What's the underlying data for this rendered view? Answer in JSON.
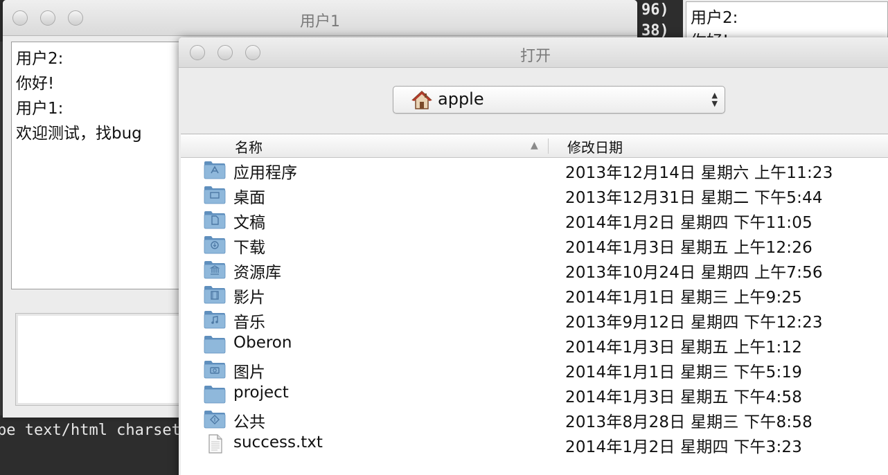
{
  "terminal": {
    "bottom_line": "pe text/html charset",
    "top_glyphs": [
      "96)",
      "38)"
    ]
  },
  "background_chat": {
    "text": "用户2:\n你好!"
  },
  "chat_window": {
    "title": "用户1",
    "log_text": "用户2:\n你好!\n用户1:\n欢迎测试，找bug",
    "input_value": ""
  },
  "open_dialog": {
    "title": "打开",
    "location": {
      "label": "apple",
      "icon": "home-icon"
    },
    "columns": {
      "name": "名称",
      "date": "修改日期",
      "sort_indicator": "▲"
    },
    "files": [
      {
        "name": "应用程序",
        "date": "2013年12月14日 星期六 上午11:23",
        "icon": "applications-folder-icon"
      },
      {
        "name": "桌面",
        "date": "2013年12月31日 星期二 下午5:44",
        "icon": "desktop-folder-icon"
      },
      {
        "name": "文稿",
        "date": "2014年1月2日 星期四 下午11:05",
        "icon": "documents-folder-icon"
      },
      {
        "name": "下载",
        "date": "2014年1月3日 星期五 上午12:26",
        "icon": "downloads-folder-icon"
      },
      {
        "name": "资源库",
        "date": "2013年10月24日 星期四 上午7:56",
        "icon": "library-folder-icon"
      },
      {
        "name": "影片",
        "date": "2014年1月1日 星期三 上午9:25",
        "icon": "movies-folder-icon"
      },
      {
        "name": "音乐",
        "date": "2013年9月12日 星期四 下午12:23",
        "icon": "music-folder-icon"
      },
      {
        "name": "Oberon",
        "date": "2014年1月3日 星期五 上午1:12",
        "icon": "folder-icon"
      },
      {
        "name": "图片",
        "date": "2014年1月1日 星期三 下午5:19",
        "icon": "pictures-folder-icon"
      },
      {
        "name": "project",
        "date": "2014年1月3日 星期五 下午4:58",
        "icon": "folder-icon"
      },
      {
        "name": "公共",
        "date": "2013年8月28日 星期三 下午8:58",
        "icon": "public-folder-icon"
      },
      {
        "name": "success.txt",
        "date": "2014年1月2日 星期四 下午3:23",
        "icon": "text-file-icon"
      }
    ]
  },
  "colors": {
    "folder_blue": "#8fb8db",
    "folder_blue_dark": "#5f8fbd",
    "terminal_bg": "#2d2d2d",
    "window_bg": "#ececec"
  }
}
